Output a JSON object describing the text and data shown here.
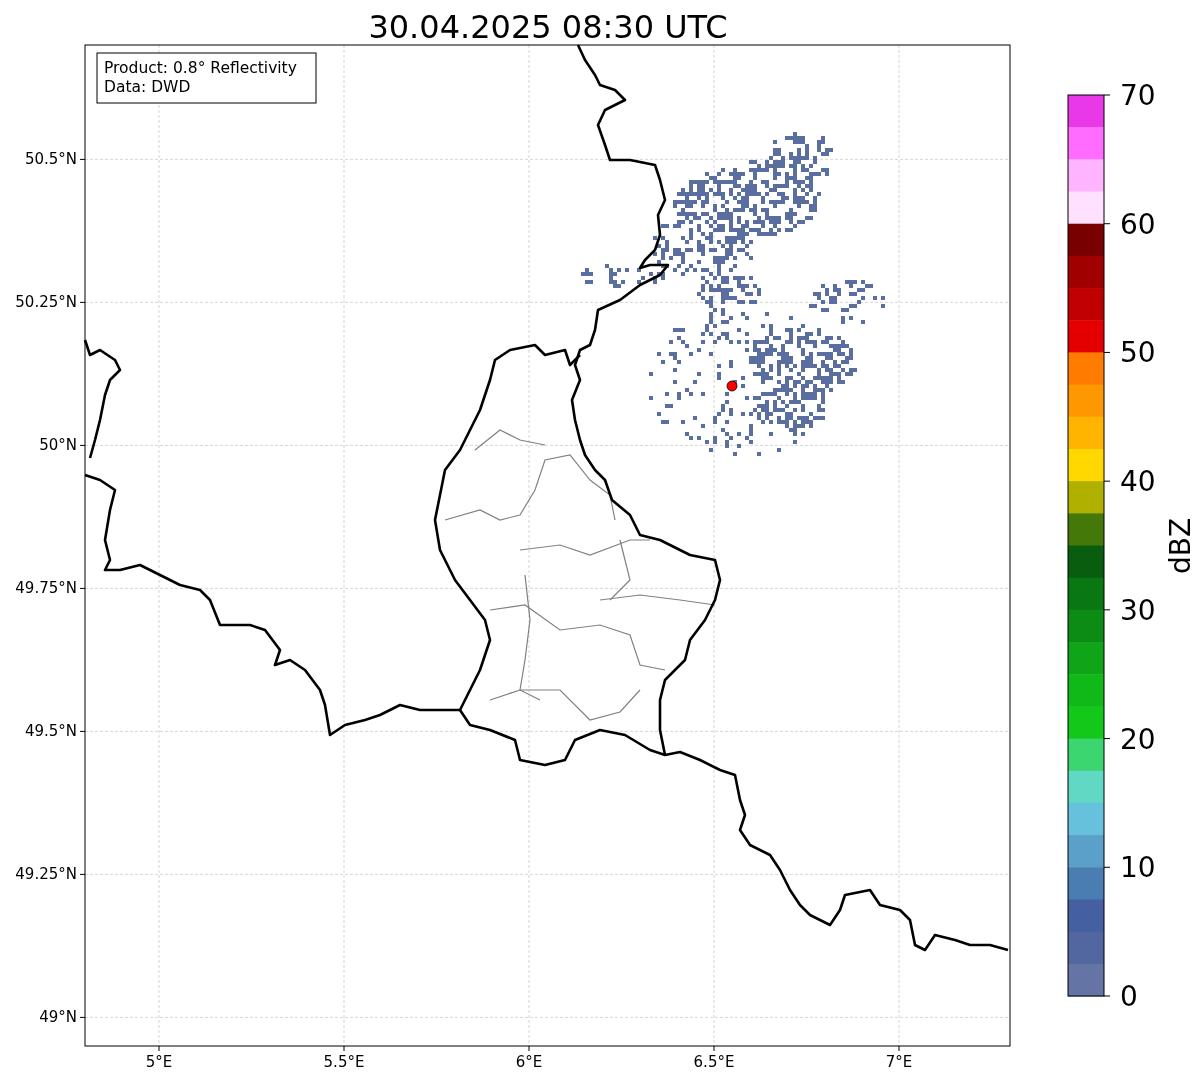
{
  "title": "30.04.2025 08:30 UTC",
  "info_box": [
    "Product: 0.8° Reflectivity",
    "Data: DWD"
  ],
  "map": {
    "chart_data": {
      "type": "scatter",
      "grid": true,
      "xlim": [
        4.8,
        7.3
      ],
      "ylim": [
        48.95,
        50.7
      ],
      "xticks": [
        {
          "value": 5,
          "label": "5°E"
        },
        {
          "value": 5.5,
          "label": "5.5°E"
        },
        {
          "value": 6,
          "label": "6°E"
        },
        {
          "value": 6.5,
          "label": "6.5°E"
        },
        {
          "value": 7,
          "label": "7°E"
        }
      ],
      "yticks": [
        {
          "value": 49,
          "label": "49°N"
        },
        {
          "value": 49.25,
          "label": "49.25°N"
        },
        {
          "value": 49.5,
          "label": "49.5°N"
        },
        {
          "value": 49.75,
          "label": "49.75°N"
        },
        {
          "value": 50,
          "label": "50°N"
        },
        {
          "value": 50.25,
          "label": "50.25°N"
        },
        {
          "value": 50.5,
          "label": "50.5°N"
        }
      ]
    }
  },
  "colorbar": {
    "label": "dBZ",
    "ticks": [
      "70",
      "60",
      "50",
      "40",
      "30",
      "20",
      "10",
      "0"
    ],
    "bins": [
      {
        "color": "#e838e8"
      },
      {
        "color": "#ff6cff"
      },
      {
        "color": "#ffb4ff"
      },
      {
        "color": "#ffe0ff"
      },
      {
        "color": "#780000"
      },
      {
        "color": "#a00000"
      },
      {
        "color": "#c00000"
      },
      {
        "color": "#e40000"
      },
      {
        "color": "#ff7c00"
      },
      {
        "color": "#ff9800"
      },
      {
        "color": "#ffb400"
      },
      {
        "color": "#ffd800"
      },
      {
        "color": "#b0b000"
      },
      {
        "color": "#447808"
      },
      {
        "color": "#085e0e"
      },
      {
        "color": "#0a7812"
      },
      {
        "color": "#0c8c14"
      },
      {
        "color": "#10a418"
      },
      {
        "color": "#10b818"
      },
      {
        "color": "#12c818"
      },
      {
        "color": "#3cd670"
      },
      {
        "color": "#60d8c4"
      },
      {
        "color": "#66c2dc"
      },
      {
        "color": "#5aa0c8"
      },
      {
        "color": "#4a7db2"
      },
      {
        "color": "#4460a0"
      },
      {
        "color": "#5266a0"
      },
      {
        "color": "#6474a4"
      }
    ]
  }
}
